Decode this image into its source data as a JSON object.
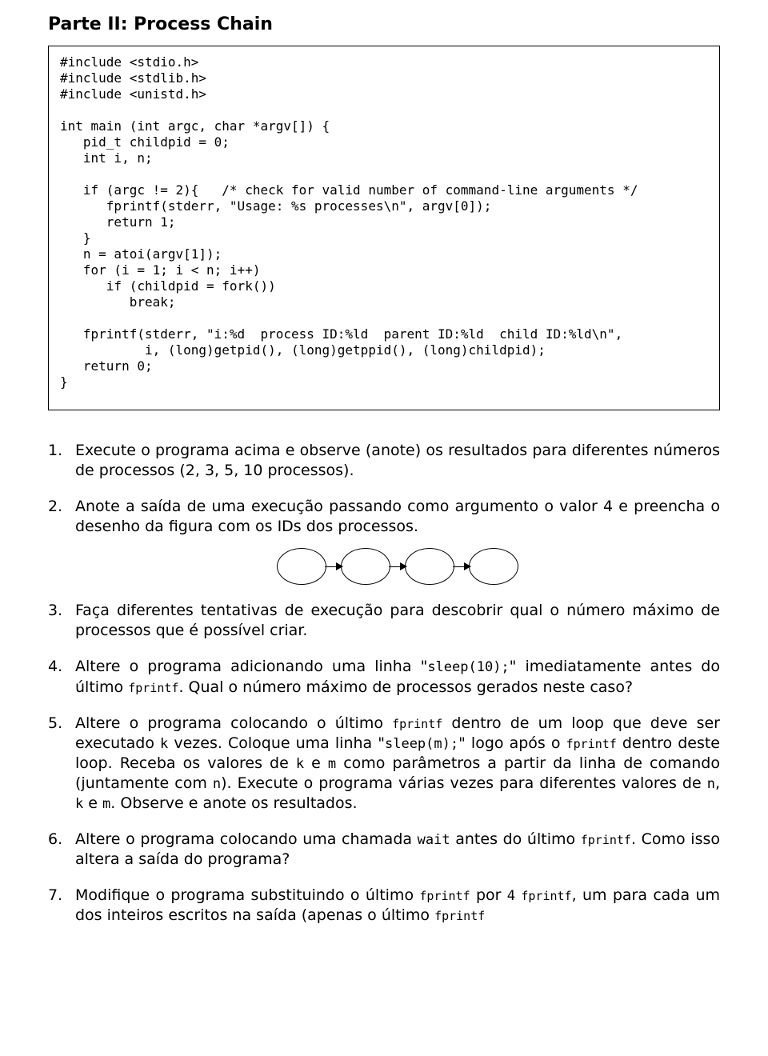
{
  "title": "Parte II: Process Chain",
  "code": "#include <stdio.h>\n#include <stdlib.h>\n#include <unistd.h>\n\nint main (int argc, char *argv[]) {\n   pid_t childpid = 0;\n   int i, n;\n\n   if (argc != 2){   /* check for valid number of command-line arguments */\n      fprintf(stderr, \"Usage: %s processes\\n\", argv[0]);\n      return 1;\n   }\n   n = atoi(argv[1]);\n   for (i = 1; i < n; i++)\n      if (childpid = fork())\n         break;\n\n   fprintf(stderr, \"i:%d  process ID:%ld  parent ID:%ld  child ID:%ld\\n\",\n           i, (long)getpid(), (long)getppid(), (long)childpid);\n   return 0;\n}",
  "q1": "Execute o programa acima e observe (anote) os resultados para diferentes números de processos (2, 3, 5, 10 processos).",
  "q2": "Anote a saída de uma execução passando como argumento o valor 4 e preencha o desenho da figura com os IDs dos processos.",
  "q3": "Faça diferentes tentativas de execução para descobrir qual o número máximo de processos que é possível criar.",
  "q4": {
    "a": "Altere o programa adicionando uma linha \"",
    "code1": "sleep(10);",
    "b": "\" imediatamente antes do último ",
    "code2": "fprintf",
    "c": ". Qual o número máximo de processos gerados neste caso?"
  },
  "q5": {
    "a": "Altere o programa colocando o último ",
    "code1": "fprintf",
    "b": " dentro de um loop que deve ser executado ",
    "code2": "k",
    "c": " vezes. Coloque uma linha \"",
    "code3": "sleep(m);",
    "d": "\" logo após o ",
    "code4": "fprintf",
    "e": " dentro deste loop. Receba os valores de ",
    "code5": "k",
    "f": " e ",
    "code6": "m",
    "g": " como parâmetros a partir da linha de comando (juntamente com ",
    "code7": "n",
    "h": "). Execute o programa várias vezes para diferentes valores de ",
    "code8": "n",
    "i": ", ",
    "code9": "k",
    "j": " e ",
    "code10": "m",
    "k": ". Observe e anote os resultados."
  },
  "q6": {
    "a": "Altere o programa colocando uma chamada ",
    "code1": "wait",
    "b": " antes do último ",
    "code2": "fprintf",
    "c": ". Como isso altera a saída do programa?"
  },
  "q7": {
    "a": "Modifique o programa substituindo o último ",
    "code1": "fprintf",
    "b": " por ",
    "code2": "4",
    "c": "  ",
    "code3": "fprintf",
    "d": ", um para cada um dos inteiros escritos na saída (apenas o último ",
    "code4": "fprintf"
  }
}
